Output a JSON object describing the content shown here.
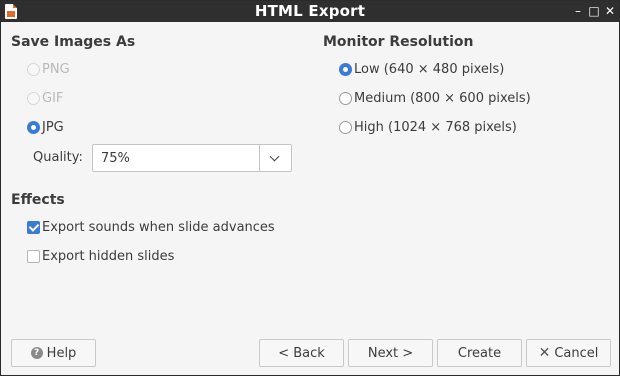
{
  "window": {
    "title": "HTML Export",
    "controls": {
      "minimize": "–",
      "maximize": "□",
      "close": "✕"
    }
  },
  "save_images": {
    "heading": "Save Images As",
    "options": [
      {
        "label": "PNG",
        "checked": false,
        "disabled": true
      },
      {
        "label": "GIF",
        "checked": false,
        "disabled": true
      },
      {
        "label": "JPG",
        "checked": true,
        "disabled": false
      }
    ],
    "quality_label": "Quality:",
    "quality_value": "75%"
  },
  "monitor_resolution": {
    "heading": "Monitor Resolution",
    "options": [
      {
        "label": "Low (640 × 480 pixels)",
        "checked": true
      },
      {
        "label": "Medium (800 × 600 pixels)",
        "checked": false
      },
      {
        "label": "High (1024 × 768 pixels)",
        "checked": false
      }
    ]
  },
  "effects": {
    "heading": "Effects",
    "options": [
      {
        "label": "Export sounds when slide advances",
        "checked": true
      },
      {
        "label": "Export hidden slides",
        "checked": false
      }
    ]
  },
  "buttons": {
    "help": "Help",
    "back": "< Back",
    "next": "Next >",
    "create": "Create",
    "cancel": "Cancel"
  },
  "colors": {
    "accent": "#3a7bd5",
    "titlebar": "#2f2f2f",
    "dialog_bg": "#f5f5f5"
  }
}
